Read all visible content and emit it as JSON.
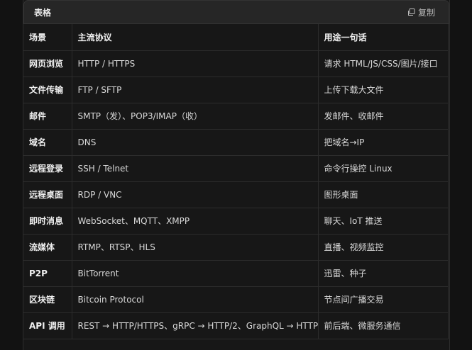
{
  "header": {
    "title": "表格",
    "copy_label": "复制"
  },
  "table": {
    "columns": [
      "场景",
      "主流协议",
      "用途一句话"
    ],
    "rows": [
      [
        "网页浏览",
        "HTTP / HTTPS",
        "请求 HTML/JS/CSS/图片/接口"
      ],
      [
        "文件传输",
        "FTP / SFTP",
        "上传下载大文件"
      ],
      [
        "邮件",
        "SMTP（发）、POP3/IMAP（收）",
        "发邮件、收邮件"
      ],
      [
        "域名",
        "DNS",
        "把域名→IP"
      ],
      [
        "远程登录",
        "SSH / Telnet",
        "命令行操控 Linux"
      ],
      [
        "远程桌面",
        "RDP / VNC",
        "图形桌面"
      ],
      [
        "即时消息",
        "WebSocket、MQTT、XMPP",
        "聊天、IoT 推送"
      ],
      [
        "流媒体",
        "RTMP、RTSP、HLS",
        "直播、视频监控"
      ],
      [
        "P2P",
        "BitTorrent",
        "迅雷、种子"
      ],
      [
        "区块链",
        "Bitcoin Protocol",
        "节点间广播交易"
      ],
      [
        "API 调用",
        "REST → HTTP/HTTPS、gRPC → HTTP/2、GraphQL → HTTP",
        "前后端、微服务通信"
      ]
    ]
  }
}
